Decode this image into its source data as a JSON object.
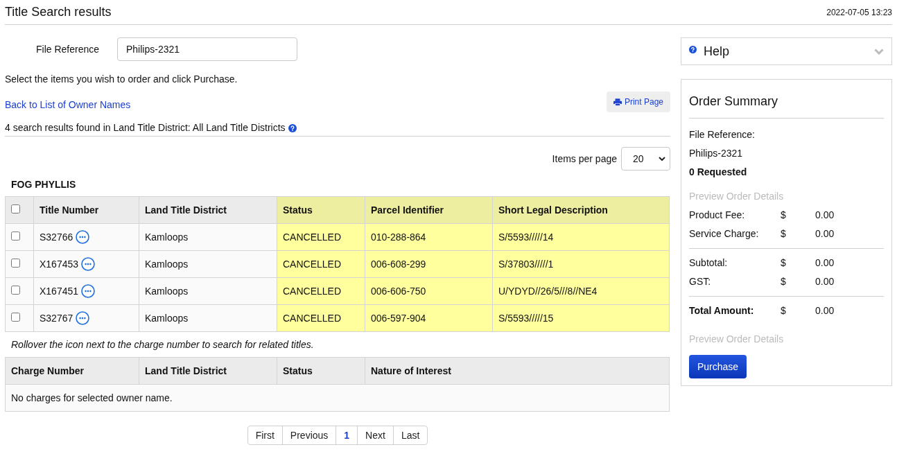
{
  "page_title": "Title Search results",
  "timestamp": "2022-07-05 13:23",
  "file_reference": {
    "label": "File Reference",
    "value": "Philips-2321"
  },
  "instruction": "Select the items you wish to order and click Purchase.",
  "back_link": "Back to List of Owner Names",
  "print_button": "Print Page",
  "results_summary": "4 search results found in Land Title District: All Land Title Districts",
  "items_per_page": {
    "label": "Items per page",
    "value": "20"
  },
  "owner_name": "FOG PHYLLIS",
  "titles_table": {
    "select_all_checked": false,
    "columns": [
      {
        "label": "Title Number",
        "highlighted": false
      },
      {
        "label": "Land Title District",
        "highlighted": false
      },
      {
        "label": "Status",
        "highlighted": true
      },
      {
        "label": "Parcel Identifier",
        "highlighted": true
      },
      {
        "label": "Short Legal Description",
        "highlighted": true
      }
    ],
    "rows": [
      {
        "checked": false,
        "title_number": "S32766",
        "district": "Kamloops",
        "status": "CANCELLED",
        "parcel": "010-288-864",
        "legal": "S/5593/////14"
      },
      {
        "checked": false,
        "title_number": "X167453",
        "district": "Kamloops",
        "status": "CANCELLED",
        "parcel": "006-608-299",
        "legal": "S/37803/////1"
      },
      {
        "checked": false,
        "title_number": "X167451",
        "district": "Kamloops",
        "status": "CANCELLED",
        "parcel": "006-606-750",
        "legal": "U/YDYD//26/5///8//NE4"
      },
      {
        "checked": false,
        "title_number": "S32767",
        "district": "Kamloops",
        "status": "CANCELLED",
        "parcel": "006-597-904",
        "legal": "S/5593/////15"
      }
    ]
  },
  "rollover_note": "Rollover the icon next to the charge number to search for related titles.",
  "charges_table": {
    "columns": [
      "Charge Number",
      "Land Title District",
      "Status",
      "Nature of Interest"
    ],
    "empty_message": "No charges for selected owner name."
  },
  "pagination": [
    {
      "label": "First",
      "selected": false
    },
    {
      "label": "Previous",
      "selected": false
    },
    {
      "label": "1",
      "selected": true
    },
    {
      "label": "Next",
      "selected": false
    },
    {
      "label": "Last",
      "selected": false
    }
  ],
  "help": {
    "title": "Help",
    "expanded": false
  },
  "order_summary": {
    "title": "Order Summary",
    "file_reference_label": "File Reference:",
    "file_reference_value": "Philips-2321",
    "requested": "0 Requested",
    "preview_top": {
      "label": "Preview Order Details",
      "disabled": true
    },
    "groups": [
      [
        {
          "label": "Product Fee:",
          "currency": "$",
          "amount": "0.00",
          "bold": false
        },
        {
          "label": "Service Charge:",
          "currency": "$",
          "amount": "0.00",
          "bold": false
        }
      ],
      [
        {
          "label": "Subtotal:",
          "currency": "$",
          "amount": "0.00",
          "bold": false
        },
        {
          "label": "GST:",
          "currency": "$",
          "amount": "0.00",
          "bold": false
        }
      ],
      [
        {
          "label": "Total Amount:",
          "currency": "$",
          "amount": "0.00",
          "bold": true
        }
      ]
    ],
    "preview_bottom": {
      "label": "Preview Order Details",
      "disabled": true
    },
    "purchase_button": "Purchase"
  }
}
